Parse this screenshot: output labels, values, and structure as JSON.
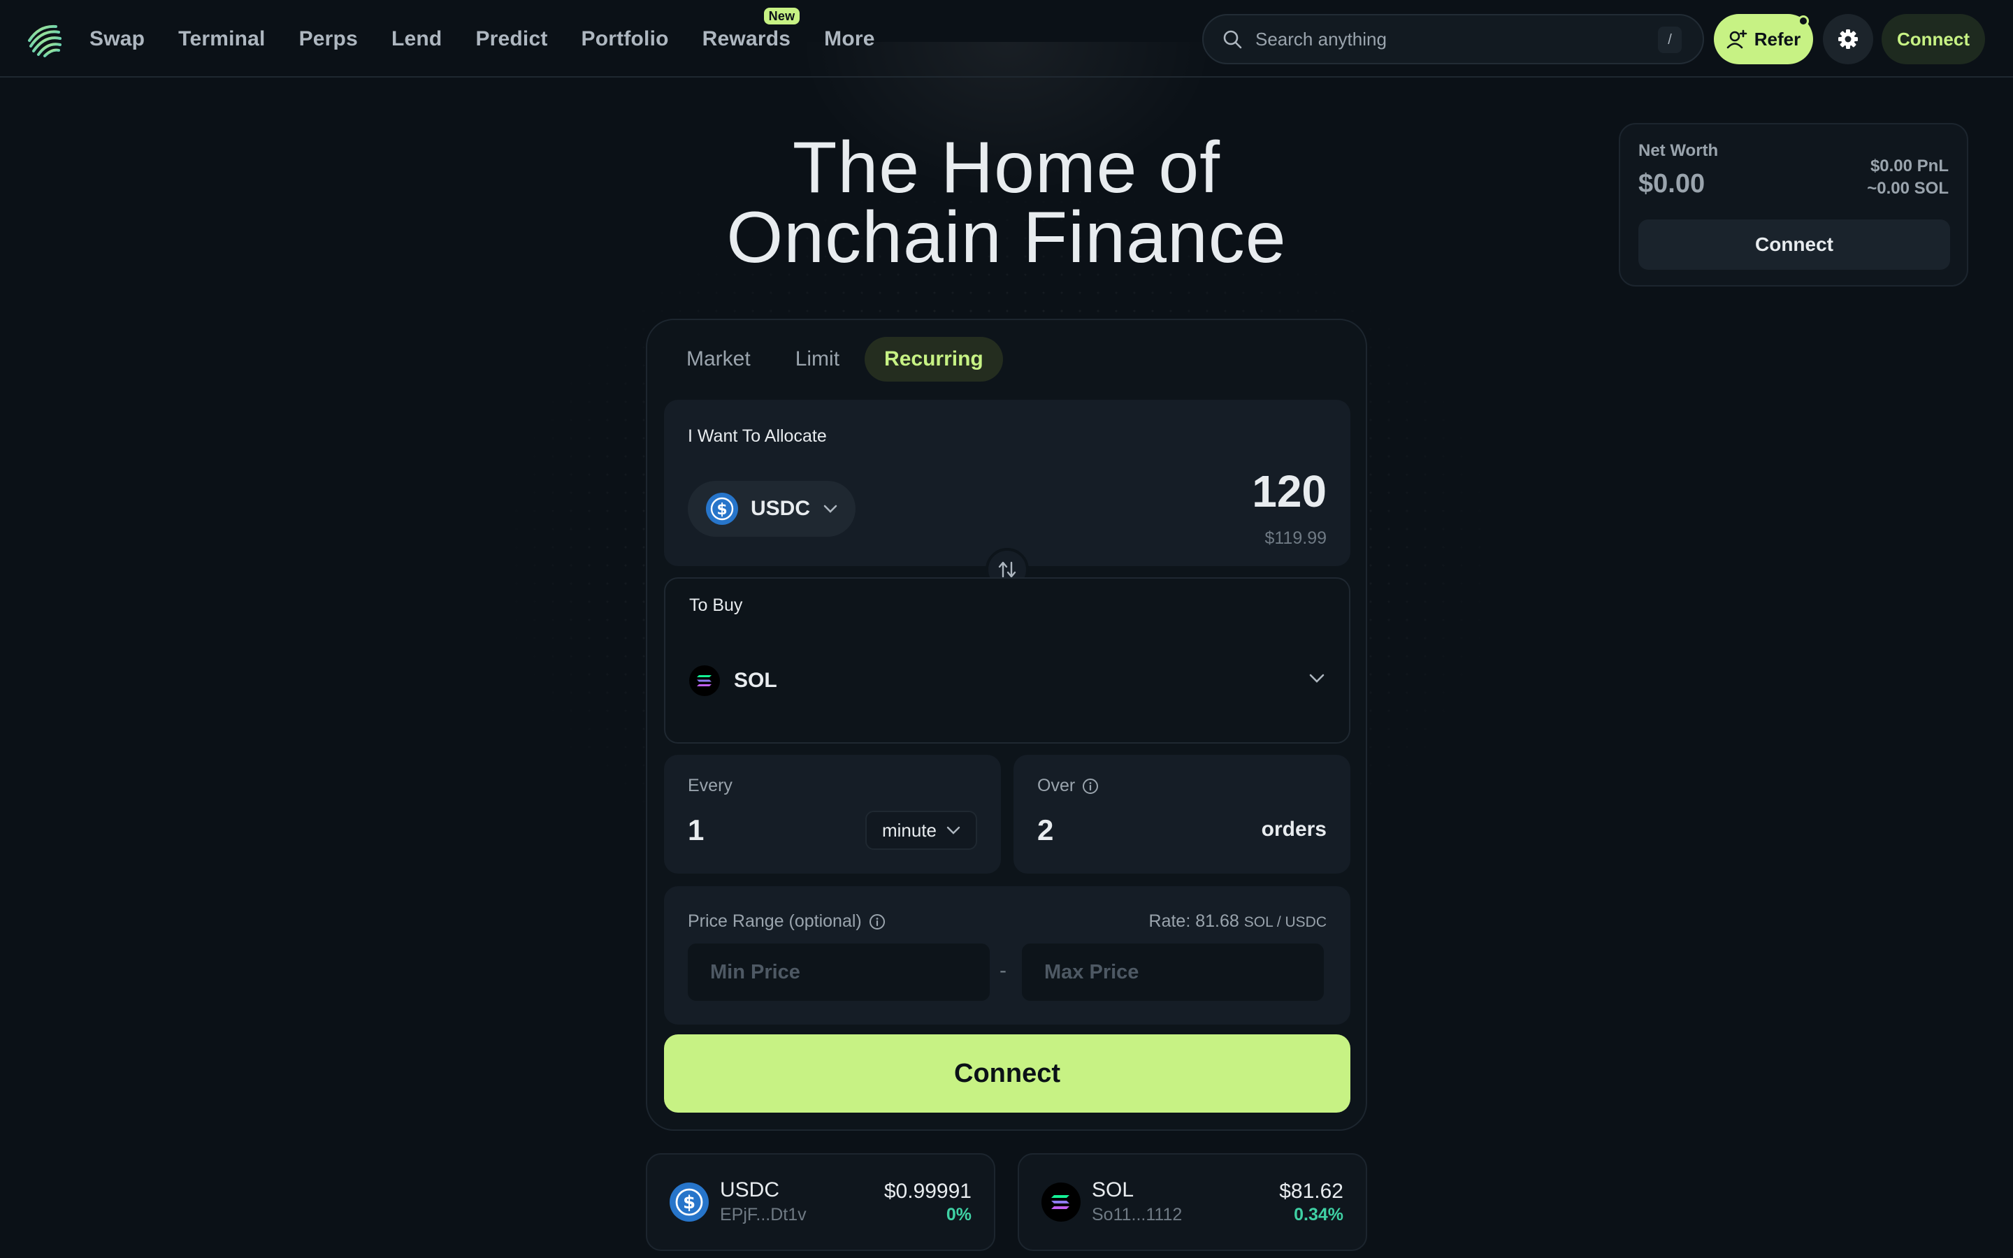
{
  "nav": {
    "items": [
      "Swap",
      "Terminal",
      "Perps",
      "Lend",
      "Predict",
      "Portfolio",
      "Rewards",
      "More"
    ],
    "new_badge": "New"
  },
  "search": {
    "placeholder": "Search anything",
    "shortcut": "/"
  },
  "header": {
    "refer_label": "Refer",
    "connect_label": "Connect"
  },
  "hero": {
    "line1": "The Home of",
    "line2": "Onchain Finance"
  },
  "net_worth": {
    "label": "Net Worth",
    "value": "$0.00",
    "pnl": "$0.00 PnL",
    "sol": "~0.00 SOL",
    "connect_label": "Connect"
  },
  "swap": {
    "tabs": [
      "Market",
      "Limit",
      "Recurring"
    ],
    "active_tab": "Recurring",
    "allocate": {
      "label": "I Want To Allocate",
      "token": "USDC",
      "amount": "120",
      "amount_usd": "$119.99"
    },
    "buy": {
      "label": "To Buy",
      "token": "SOL"
    },
    "every": {
      "label": "Every",
      "value": "1",
      "unit": "minute"
    },
    "over": {
      "label": "Over",
      "value": "2",
      "unit": "orders"
    },
    "price_range": {
      "label": "Price Range (optional)",
      "rate_label": "Rate:",
      "rate_value": "81.68",
      "rate_pair": "SOL / USDC",
      "min_placeholder": "Min Price",
      "max_placeholder": "Max Price",
      "separator": "-"
    },
    "connect_label": "Connect"
  },
  "token_cards": [
    {
      "name": "USDC",
      "address": "EPjF...Dt1v",
      "price": "$0.99991",
      "change": "0%"
    },
    {
      "name": "SOL",
      "address": "So11...1112",
      "price": "$81.62",
      "change": "0.34%"
    }
  ],
  "colors": {
    "background": "#0b1117",
    "accent": "#c7f284",
    "panel": "#151d26",
    "positive": "#3fd1a4",
    "usdc": "#2775ca"
  },
  "icons": [
    "logo-icon",
    "search-icon",
    "add-user-icon",
    "gear-icon",
    "usdc-icon",
    "sol-icon",
    "chevron-down-icon",
    "swap-arrows-icon",
    "info-icon"
  ]
}
